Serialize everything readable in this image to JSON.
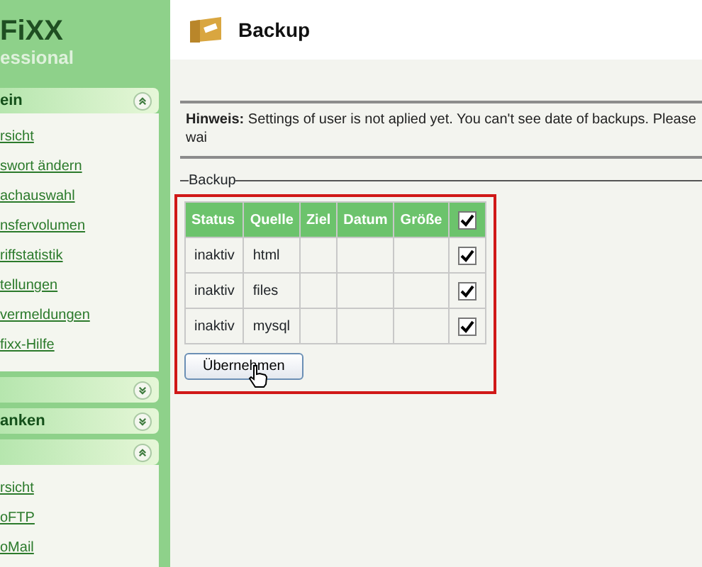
{
  "logo": {
    "brand": "FiXX",
    "edition": "essional"
  },
  "sidebar": {
    "sections": [
      {
        "title": "ein",
        "expanded": true,
        "items": [
          "rsicht",
          "swort ändern",
          "achauswahl",
          "nsfervolumen",
          "riffstatistik",
          "tellungen",
          "vermeldungen",
          "fixx-Hilfe"
        ]
      },
      {
        "expanded": false
      },
      {
        "title": "anken",
        "expanded": false
      },
      {
        "expanded": true,
        "items": [
          "rsicht",
          "oFTP",
          "oMail"
        ]
      }
    ]
  },
  "page": {
    "title": "Backup"
  },
  "notice": {
    "label": "Hinweis:",
    "text": "Settings of user is not aplied yet. You can't see date of backups. Please wai"
  },
  "backup": {
    "legend": "Backup",
    "columns": [
      "Status",
      "Quelle",
      "Ziel",
      "Datum",
      "Größe"
    ],
    "all_checked": true,
    "rows": [
      {
        "status": "inaktiv",
        "source": "html",
        "checked": true
      },
      {
        "status": "inaktiv",
        "source": "files",
        "checked": true
      },
      {
        "status": "inaktiv",
        "source": "mysql",
        "checked": true
      }
    ],
    "button": "Übernehmen"
  }
}
